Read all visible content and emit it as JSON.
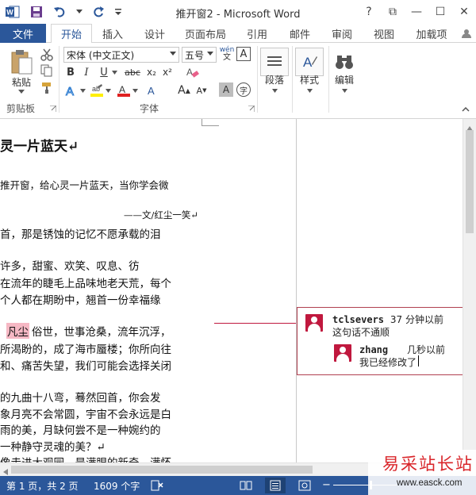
{
  "app": {
    "title": "推开窗2 - Microsoft Word"
  },
  "window_buttons": {
    "help": "?",
    "ribbon_options": "⧉",
    "minimize": "—",
    "restore": "☐",
    "close": "✕"
  },
  "tabs": {
    "file": "文件",
    "items": [
      "开始",
      "插入",
      "设计",
      "页面布局",
      "引用",
      "邮件",
      "审阅",
      "视图",
      "加载项"
    ]
  },
  "ribbon": {
    "clipboard": {
      "paste": "粘贴",
      "label": "剪贴板"
    },
    "font": {
      "font_name": "宋体 (中文正文)",
      "font_size": "五号",
      "wen": "wén",
      "label": "字体",
      "bold": "B",
      "italic": "I",
      "underline": "U",
      "strike": "abc",
      "sub": "x₂",
      "sup": "x²"
    },
    "paragraph": {
      "label": "段落"
    },
    "styles": {
      "label": "样式"
    },
    "editing": {
      "label": "编辑"
    }
  },
  "document": {
    "lines": [
      "灵一片蓝天↵",
      "推开窗，给心灵一片蓝天，当你学会微",
      "——文/红尘一笑↵",
      "首，那是锈蚀的记忆不愿承载的泪",
      "许多，甜蜜、欢笑、叹息、彷",
      "在流年的睫毛上品味地老天荒，每个",
      "个人都在期盼中，翘首一份幸福缘",
      "凡尘",
      "俗世，世事沧桑，流年沉浮，",
      "所渴盼的，成了海市蜃楼；你所向往",
      "和、痛苦失望，我们可能会选择关闭",
      "的九曲十八弯，蓦然回首，你会发",
      "象月亮不会常圆，宇宙不会永远是白",
      "雨的美，月缺何尝不是一种婉约的",
      "一种静守灵魂的美？↵",
      "像走进大观园，是满眼的新奇，满怀"
    ]
  },
  "comments": [
    {
      "author": "tclsevers",
      "time": "37 分钟以前",
      "text": "这句话不通顺"
    },
    {
      "author": "zhang",
      "time": "几秒以前",
      "text": "我已经修改了"
    }
  ],
  "status": {
    "page": "第 1 页，共 2 页",
    "words": "1609 个字"
  },
  "watermark": {
    "brand": "易采站长站",
    "url": "www.easck.com"
  }
}
